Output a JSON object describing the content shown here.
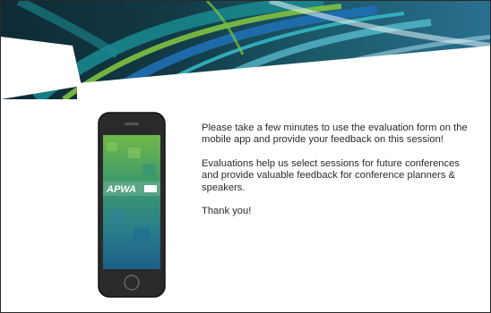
{
  "slide": {
    "paragraphs": [
      "Please take a few minutes to use the evaluation form on the mobile app and provide your feedback on this session!",
      "Evaluations help us select sessions for future conferences and provide valuable feedback for conference planners & speakers.",
      "Thank you!"
    ]
  },
  "phone": {
    "app_logo": "APWA"
  },
  "colors": {
    "banner_dark": "#0f2f3a",
    "banner_teal": "#1a8a90",
    "banner_green": "#7fc241",
    "banner_blue": "#1f6fb2",
    "phone_body": "#2a2a2a",
    "screen_top": "#7ac043",
    "screen_bottom": "#1f6e8c",
    "text": "#2b2b2b"
  }
}
